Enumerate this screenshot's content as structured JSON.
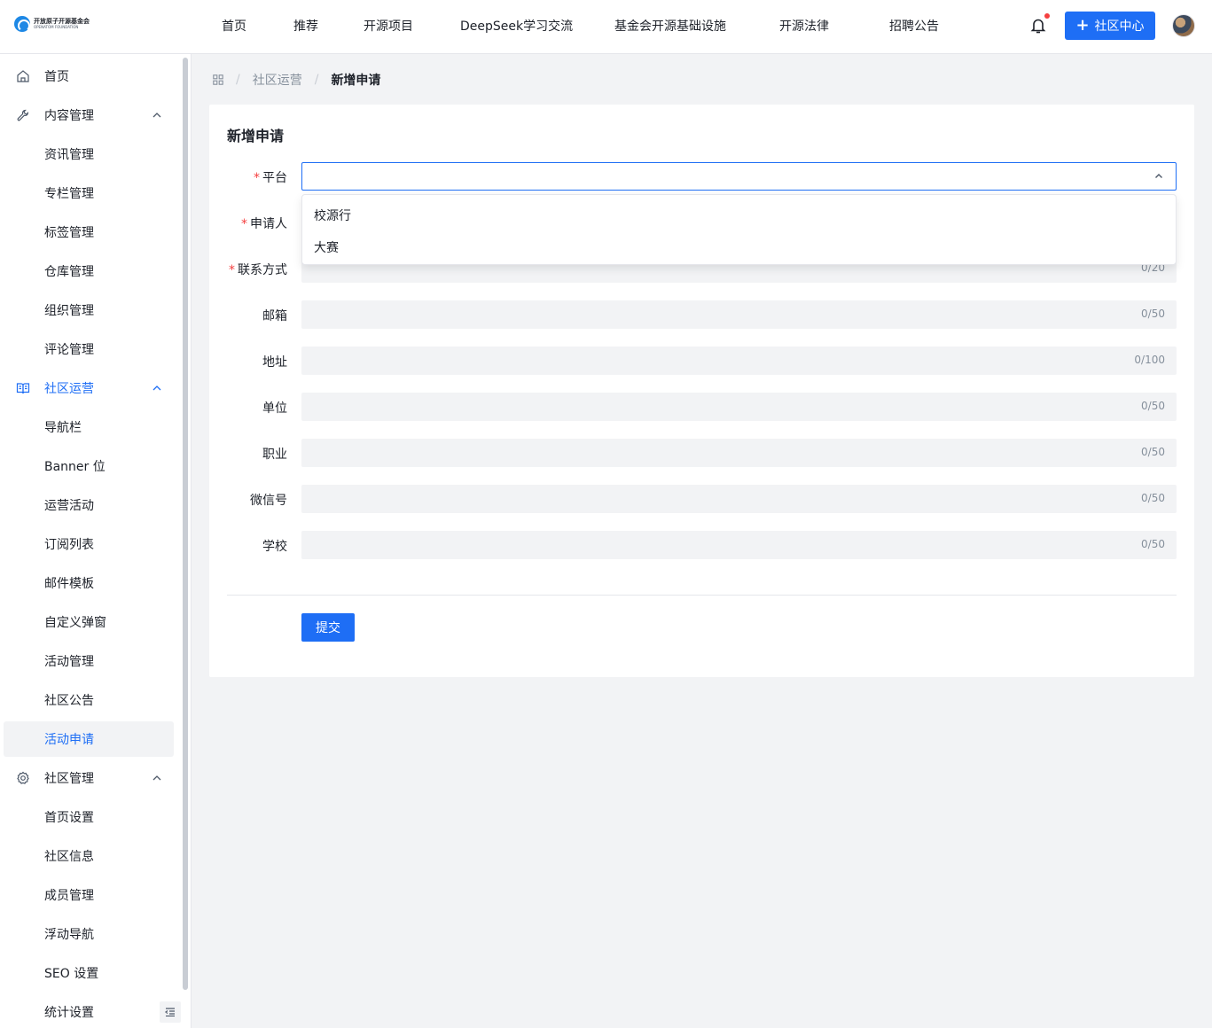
{
  "logo": {
    "cn": "开放原子开源基金会",
    "en": "OPENATOM FOUNDATION"
  },
  "nav": [
    "首页",
    "推荐",
    "开源项目",
    "DeepSeek学习交流",
    "基金会开源基础设施",
    "开源法律",
    "招聘公告"
  ],
  "header": {
    "cta_label": "社区中心"
  },
  "sidebar": {
    "items": [
      {
        "label": "首页",
        "icon": "home-icon",
        "type": "top"
      },
      {
        "label": "内容管理",
        "icon": "wrench-icon",
        "type": "group"
      },
      {
        "label": "资讯管理",
        "type": "sub"
      },
      {
        "label": "专栏管理",
        "type": "sub"
      },
      {
        "label": "标签管理",
        "type": "sub"
      },
      {
        "label": "仓库管理",
        "type": "sub"
      },
      {
        "label": "组织管理",
        "type": "sub"
      },
      {
        "label": "评论管理",
        "type": "sub"
      },
      {
        "label": "社区运营",
        "icon": "book-icon",
        "type": "group-active"
      },
      {
        "label": "导航栏",
        "type": "sub"
      },
      {
        "label": "Banner 位",
        "type": "sub"
      },
      {
        "label": "运营活动",
        "type": "sub"
      },
      {
        "label": "订阅列表",
        "type": "sub"
      },
      {
        "label": "邮件模板",
        "type": "sub"
      },
      {
        "label": "自定义弹窗",
        "type": "sub"
      },
      {
        "label": "活动管理",
        "type": "sub"
      },
      {
        "label": "社区公告",
        "type": "sub"
      },
      {
        "label": "活动申请",
        "type": "selected"
      },
      {
        "label": "社区管理",
        "icon": "gear-icon",
        "type": "group"
      },
      {
        "label": "首页设置",
        "type": "sub"
      },
      {
        "label": "社区信息",
        "type": "sub"
      },
      {
        "label": "成员管理",
        "type": "sub"
      },
      {
        "label": "浮动导航",
        "type": "sub"
      },
      {
        "label": "SEO 设置",
        "type": "sub"
      },
      {
        "label": "统计设置",
        "type": "sub"
      }
    ]
  },
  "breadcrumb": {
    "parent": "社区运营",
    "current": "新增申请",
    "separator": "/"
  },
  "form": {
    "title": "新增申请",
    "required_mark": "*",
    "platform": {
      "label": "平台",
      "value": "",
      "options": [
        "校源行",
        "大赛"
      ]
    },
    "fields": [
      {
        "label": "申请人",
        "required": true,
        "count": ""
      },
      {
        "label": "联系方式",
        "required": true,
        "count": "0/20"
      },
      {
        "label": "邮箱",
        "required": false,
        "count": "0/50"
      },
      {
        "label": "地址",
        "required": false,
        "count": "0/100"
      },
      {
        "label": "单位",
        "required": false,
        "count": "0/50"
      },
      {
        "label": "职业",
        "required": false,
        "count": "0/50"
      },
      {
        "label": "微信号",
        "required": false,
        "count": "0/50"
      },
      {
        "label": "学校",
        "required": false,
        "count": "0/50"
      }
    ],
    "submit_label": "提交"
  },
  "colors": {
    "primary": "#1e6ef5",
    "required": "#f53f3f",
    "bell_dot": "#f53f3f"
  }
}
